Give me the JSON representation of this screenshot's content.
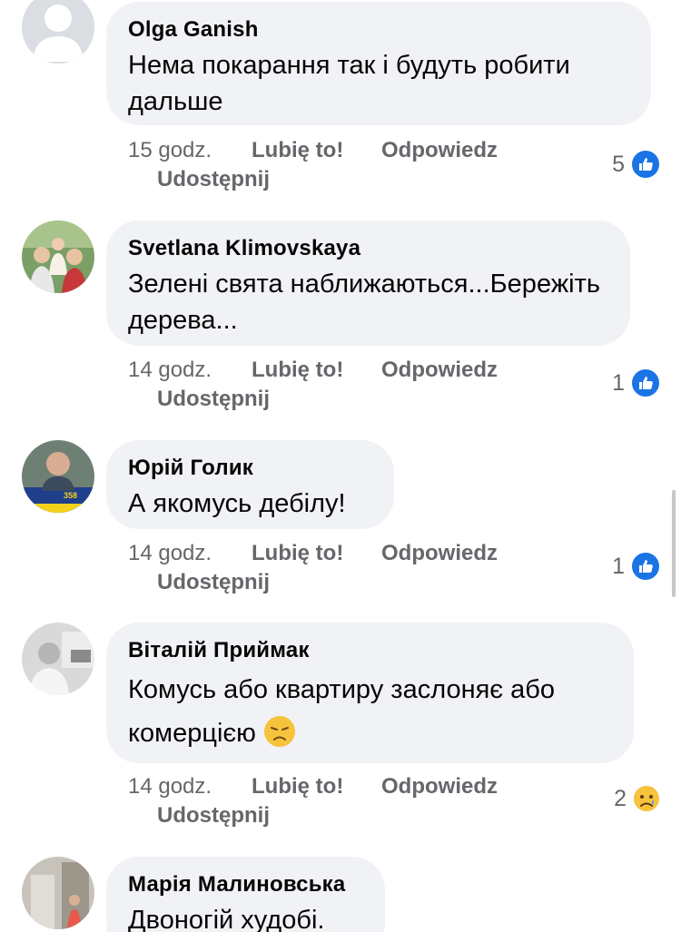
{
  "comments": [
    {
      "author": "Olga Ganish",
      "text": "Нема покарання так і будуть робити дальше",
      "time": "15 godz.",
      "like": "Lubię to!",
      "reply": "Odpowiedz",
      "share": "Udostępnij",
      "reaction_count": "5",
      "reaction_type": "like-icon",
      "avatar": "default-avatar-icon"
    },
    {
      "author": "Svetlana  Klimovskaya",
      "text": "Зелені свята наближаються...Бережіть дерева...",
      "time": "14 godz.",
      "like": "Lubię to!",
      "reply": "Odpowiedz",
      "share": "Udostępnij",
      "reaction_count": "1",
      "reaction_type": "like-icon",
      "avatar": "family-photo-avatar"
    },
    {
      "author": "Юрій Голик",
      "text": "А якомусь дебілу!",
      "time": "14 godz.",
      "like": "Lubię to!",
      "reply": "Odpowiedz",
      "share": "Udostępnij",
      "reaction_count": "1",
      "reaction_type": "like-icon",
      "avatar": "man-portrait-avatar"
    },
    {
      "author": "Віталій Приймак",
      "text": "Комусь або квартиру заслоняє або комерцією",
      "time": "14 godz.",
      "like": "Lubię to!",
      "reply": "Odpowiedz",
      "share": "Udostępnij",
      "reaction_count": "2",
      "reaction_type": "sad-icon",
      "avatar": "man-in-car-avatar",
      "emoji": "disappointed-face-icon"
    },
    {
      "author": "Марія Малиновська",
      "text": "Двоногій худобі.",
      "avatar": "statue-photo-avatar"
    }
  ],
  "colors": {
    "bubble": "#f0f2f5",
    "meta_text": "#65676b",
    "like_blue": "#1b74e4",
    "text": "#050505"
  }
}
